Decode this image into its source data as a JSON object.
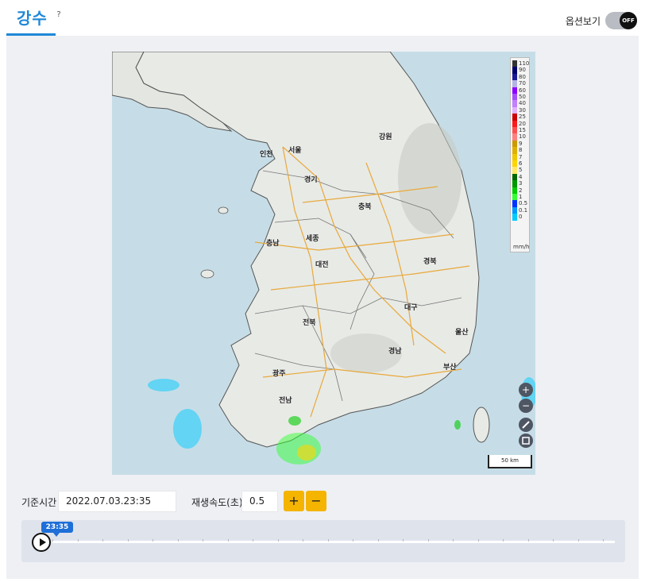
{
  "header": {
    "tab_title": "강수",
    "help_glyph": "?",
    "options_label": "옵션보기",
    "toggle_state": "OFF"
  },
  "map": {
    "city_labels": [
      "인천",
      "서울",
      "경기",
      "강원",
      "충북",
      "충남",
      "세종",
      "대전",
      "경북",
      "대구",
      "전북",
      "울산",
      "경남",
      "광주",
      "부산",
      "전남"
    ],
    "legend": {
      "items": [
        {
          "label": "110",
          "color": "#333333"
        },
        {
          "label": "90",
          "color": "#00006b"
        },
        {
          "label": "80",
          "color": "#1a1a99"
        },
        {
          "label": "70",
          "color": "#b3b3e6"
        },
        {
          "label": "60",
          "color": "#8b00ff"
        },
        {
          "label": "50",
          "color": "#a64dff"
        },
        {
          "label": "40",
          "color": "#c080ff"
        },
        {
          "label": "30",
          "color": "#e0b3ff"
        },
        {
          "label": "25",
          "color": "#cc0000"
        },
        {
          "label": "20",
          "color": "#ff1a1a"
        },
        {
          "label": "15",
          "color": "#ff5050"
        },
        {
          "label": "10",
          "color": "#ff8080"
        },
        {
          "label": "9",
          "color": "#cc9900"
        },
        {
          "label": "8",
          "color": "#e0b000"
        },
        {
          "label": "7",
          "color": "#f0c800"
        },
        {
          "label": "6",
          "color": "#ffd500"
        },
        {
          "label": "5",
          "color": "#ffe866"
        },
        {
          "label": "4",
          "color": "#006600"
        },
        {
          "label": "3",
          "color": "#009900"
        },
        {
          "label": "2",
          "color": "#00cc00"
        },
        {
          "label": "1",
          "color": "#33ff33"
        },
        {
          "label": "0.5",
          "color": "#0033ff"
        },
        {
          "label": "0.1",
          "color": "#0099ff"
        },
        {
          "label": "0",
          "color": "#00ccff"
        }
      ],
      "unit": "mm/h"
    },
    "scale_label": "50 km",
    "zoom_in_glyph": "+",
    "zoom_out_glyph": "−"
  },
  "controls": {
    "base_time_label": "기준시간",
    "base_time_value": "2022.07.03.23:35",
    "speed_label": "재생속도(초)",
    "speed_value": "0.5",
    "plus_glyph": "+",
    "minus_glyph": "−"
  },
  "timeline": {
    "current_time": "23:35",
    "progress": 0
  },
  "colors": {
    "accent": "#1e88d8",
    "button": "#f4b400",
    "badge": "#1e6fd8"
  }
}
